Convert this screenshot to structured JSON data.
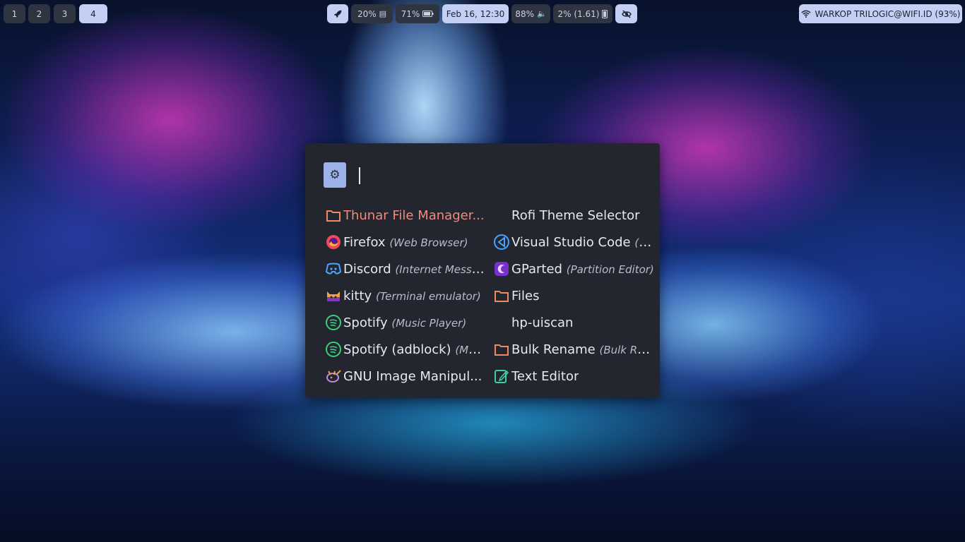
{
  "workspaces": [
    {
      "label": "1",
      "active": false
    },
    {
      "label": "2",
      "active": false
    },
    {
      "label": "3",
      "active": false
    },
    {
      "label": "4",
      "active": true
    }
  ],
  "status": {
    "launcher_icon": "rocket-icon",
    "cpu": "20%",
    "memory": "71%",
    "clock": "Feb 16, 12:30",
    "volume": "88%",
    "disk": "2% (1.61)",
    "privacy_icon": "eye-slash-icon"
  },
  "network": {
    "label": "WARKOP TRILOGIC@WIFI.ID (93%)",
    "icon": "wifi-icon"
  },
  "launcher": {
    "prompt_icon": "gears-icon",
    "query": "",
    "entries": [
      {
        "name": "Thunar File Manager...",
        "generic": "",
        "icon": "folder-icon",
        "selected": true
      },
      {
        "name": "Firefox",
        "generic": "(Web Browser)",
        "icon": "firefox-icon"
      },
      {
        "name": "Discord",
        "generic": "(Internet Messen...",
        "icon": "discord-icon"
      },
      {
        "name": "kitty",
        "generic": "(Terminal emulator)",
        "icon": "kitty-icon"
      },
      {
        "name": "Spotify",
        "generic": "(Music Player)",
        "icon": "spotify-icon"
      },
      {
        "name": "Spotify (adblock)",
        "generic": "(Musi...",
        "icon": "spotify-icon"
      },
      {
        "name": "GNU Image Manipul...",
        "generic": "",
        "icon": "gimp-icon"
      },
      {
        "name": "Rofi Theme Selector",
        "generic": "",
        "icon": ""
      },
      {
        "name": "Visual Studio Code",
        "generic": "(Te...",
        "icon": "vscode-icon"
      },
      {
        "name": "GParted",
        "generic": "(Partition Editor)",
        "icon": "gparted-icon"
      },
      {
        "name": "Files",
        "generic": "",
        "icon": "folder-icon"
      },
      {
        "name": "hp-uiscan",
        "generic": "",
        "icon": ""
      },
      {
        "name": "Bulk Rename",
        "generic": "(Bulk Ren...",
        "icon": "folder-icon"
      },
      {
        "name": "Text Editor",
        "generic": "",
        "icon": "text-editor-icon"
      }
    ]
  },
  "colors": {
    "bar_bg": "#2e3440",
    "bar_active": "#c3cff3",
    "launcher_bg": "#23262f",
    "accent": "#9db2eb",
    "selected_text": "#f08a7a"
  }
}
